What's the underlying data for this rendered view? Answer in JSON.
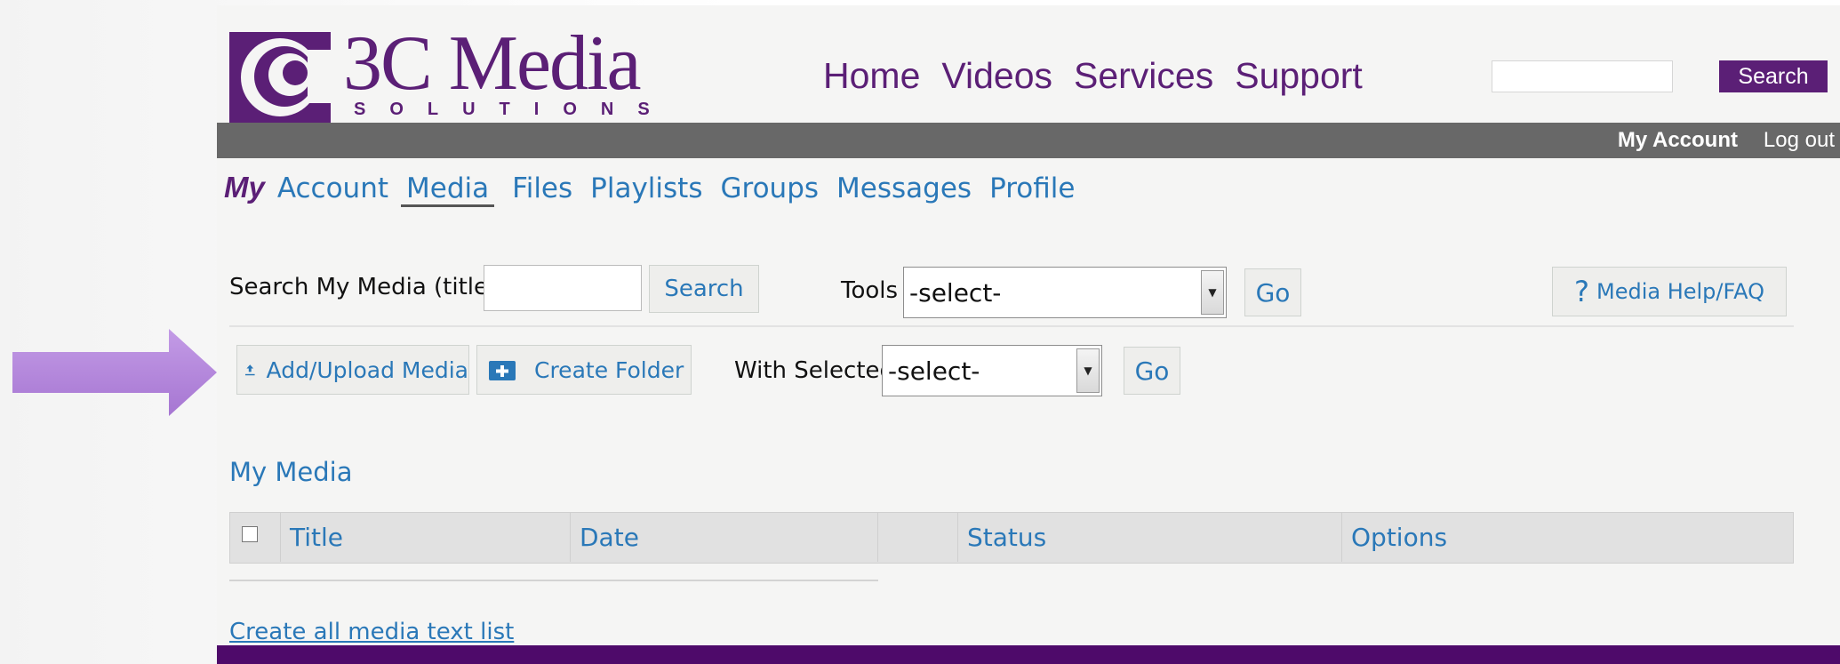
{
  "header": {
    "logo_title": "3C Media",
    "logo_subtitle": "SOLUTIONS",
    "nav": [
      "Home",
      "Videos",
      "Services",
      "Support"
    ],
    "search_button": "Search",
    "search_value": ""
  },
  "account_bar": {
    "my_account": "My Account",
    "log_out": "Log out"
  },
  "subnav": {
    "my": "My",
    "items": [
      "Account",
      "Media",
      "Files",
      "Playlists",
      "Groups",
      "Messages",
      "Profile"
    ],
    "active": "Media"
  },
  "toolbar": {
    "search_label": "Search My Media (title):",
    "search_value": "",
    "search_button": "Search",
    "tools_label": "Tools",
    "tools_selected": "-select-",
    "tools_go": "Go",
    "help_button": "Media Help/FAQ",
    "add_upload": "Add/Upload Media",
    "create_folder": "Create Folder",
    "with_selected_label": "With Selected",
    "with_selected_value": "-select-",
    "with_selected_go": "Go"
  },
  "media": {
    "title": "My Media",
    "columns": [
      "Title",
      "Date",
      "",
      "Status",
      "Options"
    ],
    "text_list_link": "Create all media text list"
  },
  "colors": {
    "brand_purple": "#5b1f76",
    "link_blue": "#2a78b8",
    "account_bar": "#686868",
    "footer": "#4e0a6a",
    "pointer_arrow": "#b78fdc"
  }
}
